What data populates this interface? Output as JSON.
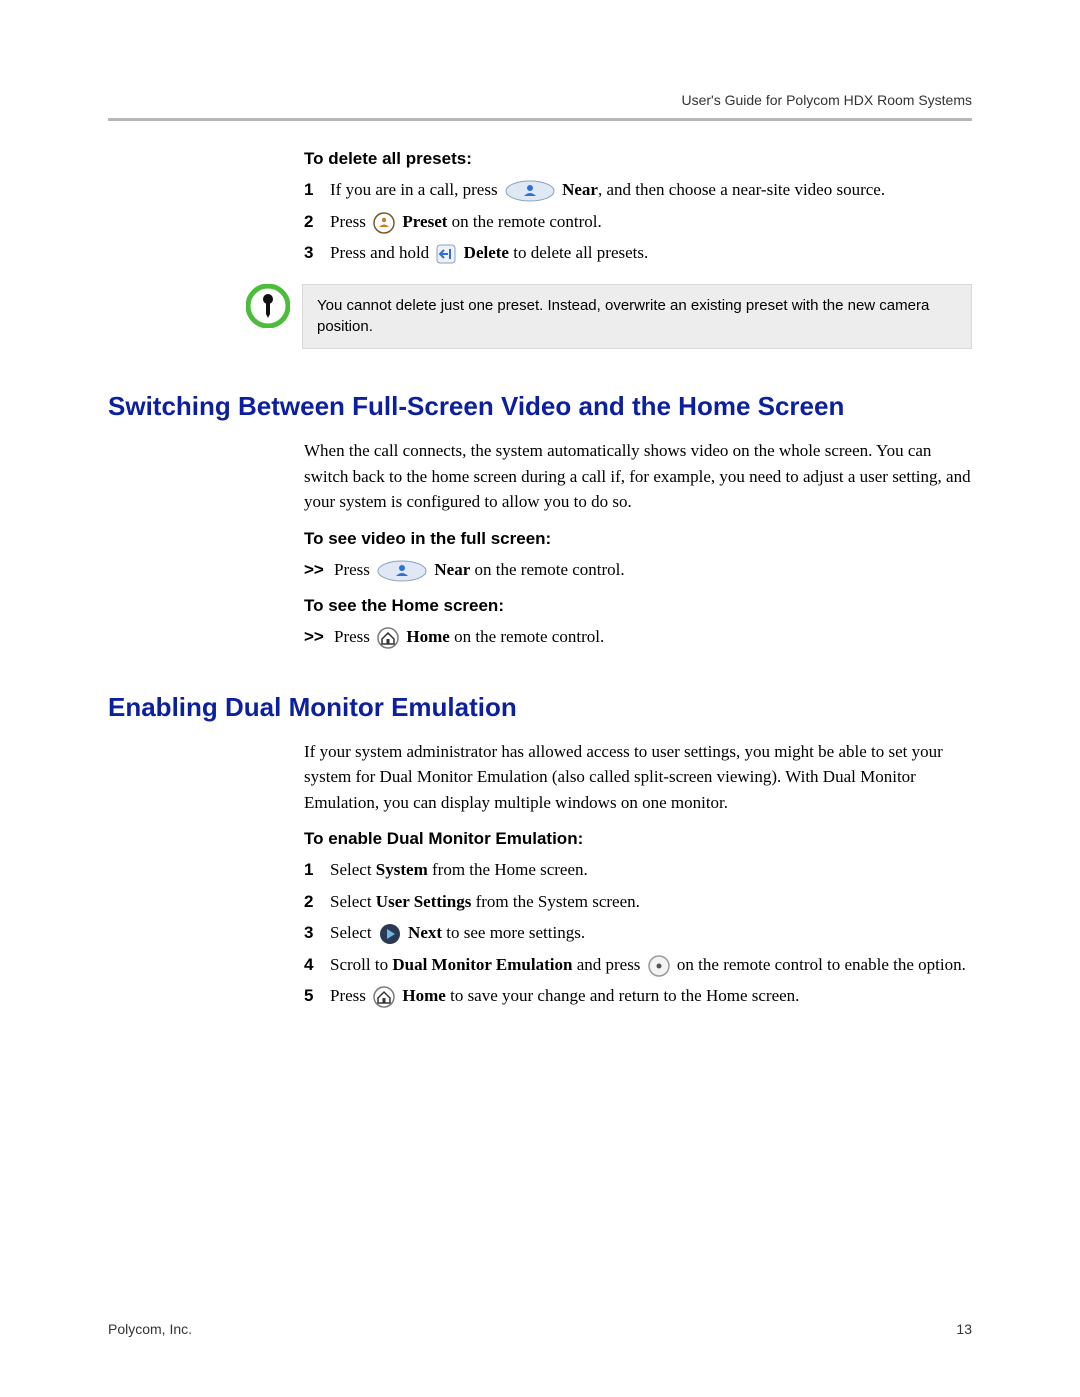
{
  "header": {
    "runhead": "User's Guide for Polycom HDX Room Systems"
  },
  "sec_delete": {
    "title": "To delete all presets:",
    "s1_a": "If you are in a call, press ",
    "s1_near": "Near",
    "s1_b": ", and then choose a near-site video source.",
    "s2_a": "Press ",
    "s2_preset": "Preset",
    "s2_b": " on the remote control.",
    "s3_a": "Press and hold ",
    "s3_delete": "Delete",
    "s3_b": " to delete all presets."
  },
  "note": {
    "text": "You cannot delete just one preset. Instead, overwrite an existing preset with the new camera position."
  },
  "sec_switch": {
    "heading": "Switching Between Full-Screen Video and the Home Screen",
    "para": "When the call connects, the system automatically shows video on the whole screen. You can switch back to the home screen during a call if, for example, you need to adjust a user setting, and your system is configured to allow you to do so.",
    "full_title": "To see video in the full screen:",
    "full_a": "Press ",
    "full_near": "Near",
    "full_b": " on the remote control.",
    "home_title": "To see the Home screen:",
    "home_a": "Press ",
    "home_home": "Home",
    "home_b": " on the remote control."
  },
  "sec_dual": {
    "heading": "Enabling Dual Monitor Emulation",
    "para": "If your system administrator has allowed access to user settings, you might be able to set your system for Dual Monitor Emulation (also called split-screen viewing). With Dual Monitor Emulation, you can display multiple windows on one monitor.",
    "title": "To enable Dual Monitor Emulation:",
    "s1_a": "Select ",
    "s1_b": "System",
    "s1_c": " from the Home screen.",
    "s2_a": "Select ",
    "s2_b": "User Settings",
    "s2_c": " from the System screen.",
    "s3_a": "Select ",
    "s3_next": "Next",
    "s3_b": " to see more settings.",
    "s4_a": "Scroll to ",
    "s4_b": "Dual Monitor Emulation",
    "s4_c": " and press ",
    "s4_d": " on the remote control to enable the option.",
    "s5_a": "Press ",
    "s5_home": "Home",
    "s5_b": " to save your change and return to the Home screen."
  },
  "nums": {
    "n1": "1",
    "n2": "2",
    "n3": "3",
    "n4": "4",
    "n5": "5",
    "arrow": ">>"
  },
  "footer": {
    "company": "Polycom, Inc.",
    "page": "13"
  }
}
